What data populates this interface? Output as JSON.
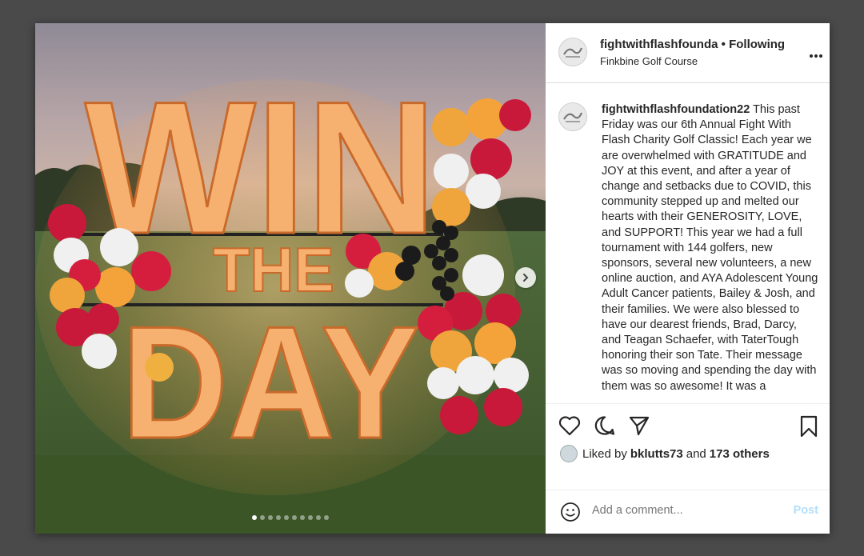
{
  "header": {
    "username": "fightwithflashfounda",
    "separator": "•",
    "follow_status": "Following",
    "location": "Finkbine Golf Course",
    "more_label": "•••"
  },
  "image": {
    "sign_line1": "WIN",
    "sign_line2": "THE",
    "sign_line3": "DAY",
    "carousel_count": 10,
    "carousel_active": 1
  },
  "caption": {
    "username": "fightwithflashfoundation22",
    "text": "This past Friday was our 6th Annual Fight With Flash Charity Golf Classic! Each year we are overwhelmed with GRATITUDE and JOY at this event, and after a year of change and setbacks due to COVID, this community stepped up and melted our hearts with their GENEROSITY, LOVE, and SUPPORT! This year we had a full tournament with 144 golfers, new sponsors, several new volunteers, a new online auction, and AYA Adolescent Young Adult Cancer patients, Bailey & Josh, and their families. We were also blessed to have our dearest friends, Brad, Darcy, and Teagan Schaefer, with TaterTough honoring their son Tate. Their message was so moving and spending the day with them was so awesome! It was a"
  },
  "likes": {
    "prefix": "Liked by",
    "user": "bklutts73",
    "conjunction": "and",
    "others": "173 others"
  },
  "comment": {
    "placeholder": "Add a comment...",
    "post_label": "Post"
  },
  "colors": {
    "page_bg": "#4a4a4a",
    "text": "#262626",
    "muted": "#8e8e8e",
    "post_disabled": "#b2dffc",
    "marquee": "#f3a35f"
  }
}
